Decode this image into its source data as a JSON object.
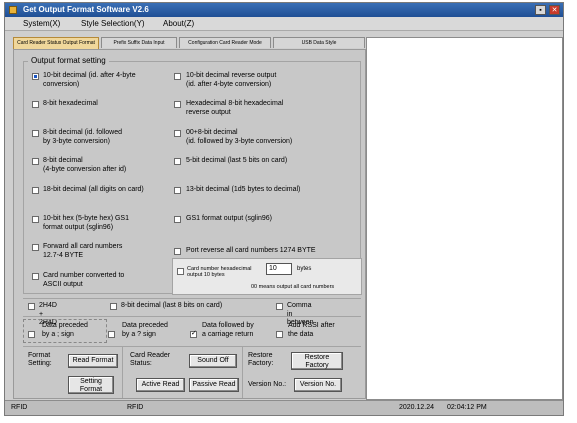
{
  "window": {
    "title": "Get Output Format Software V2.6",
    "buttons": {
      "minimize": "▪",
      "close": "✕"
    }
  },
  "menu": [
    "System(X)",
    "Style Selection(Y)",
    "About(Z)"
  ],
  "tabs": [
    {
      "label": "Card Reader Status Output Format",
      "active": true
    },
    {
      "label": "Prefix Suffix Data Input",
      "active": false
    },
    {
      "label": "Configuration Card Reader Mode",
      "active": false
    },
    {
      "label": "USB Data Style",
      "active": false
    }
  ],
  "output_format": {
    "title": "Output format setting",
    "left": [
      {
        "label": "10-bit decimal (id. after 4-byte\nconversion)",
        "checked": true
      },
      {
        "label": "8-bit hexadecimal",
        "checked": false
      },
      {
        "label": "8-bit decimal (id. followed\nby 3-byte conversion)",
        "checked": false
      },
      {
        "label": "8-bit decimal\n(4-byte conversion after id)",
        "checked": false
      },
      {
        "label": "18-bit decimal (all digits on card)",
        "checked": false
      },
      {
        "label": "10-bit hex (5-byte hex) GS1\nformat output (sglin96)",
        "checked": false
      },
      {
        "label": "Forward all card numbers\n12.7-4 BYTE",
        "checked": false
      },
      {
        "label": "Card number converted to\nASCII output",
        "checked": false
      }
    ],
    "right": [
      {
        "label": "10-bit decimal reverse output\n(id. after 4-byte conversion)",
        "checked": false
      },
      {
        "label": "Hexadecimal 8-bit hexadecimal\nreverse output",
        "checked": false
      },
      {
        "label": "00+8-bit decimal\n(id. followed by 3-byte conversion)",
        "checked": false
      },
      {
        "label": "5-bit decimal (last 5 bits on card)",
        "checked": false
      },
      {
        "label": "13-bit decimal (1d5 bytes to decimal)",
        "checked": false
      },
      {
        "label": "GS1 format output (sglin96)",
        "checked": false
      },
      {
        "label": "Port reverse all card numbers 1274 BYTE",
        "checked": false
      }
    ],
    "hex_output": {
      "label": "Card number hexadecimal\noutput 10 bytes",
      "value": "10",
      "unit": "bytes",
      "note": "00 means output all card numbers"
    }
  },
  "extra_options": [
    {
      "label": "2H4D + 2H4D",
      "checked": false
    },
    {
      "label": "8-bit decimal (last 8 bits on card)",
      "checked": false
    },
    {
      "label": "Comma in between",
      "checked": false
    }
  ],
  "data_options": [
    {
      "label": "Data preceded\nby a ; sign",
      "checked": false
    },
    {
      "label": "Data preceded\nby a ? sign",
      "checked": false
    },
    {
      "label": "Data followed by\na carriage return",
      "checked": true
    },
    {
      "label": "Add RSSI after\nthe data",
      "checked": false
    }
  ],
  "bottom": {
    "format_setting_label": "Format\nSetting:",
    "read_format": "Read Format",
    "setting_format": "Setting\nFormat",
    "card_reader_status_label": "Card Reader\nStatus:",
    "sound_off": "Sound Off",
    "active_read": "Active Read",
    "passive_read": "Passive Read",
    "restore_factory_label": "Restore\nFactory:",
    "restore_factory": "Restore\nFactory",
    "version_no_label": "Version No.:",
    "version_no": "Version No."
  },
  "status": {
    "left": "RFID",
    "middle": "RFID",
    "date": "2020.12.24",
    "time": "02:04:12 PM"
  }
}
